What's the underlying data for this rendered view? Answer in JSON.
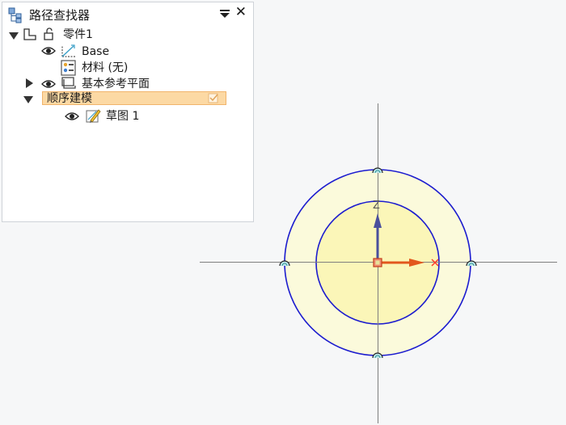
{
  "panel": {
    "title": "路径查找器",
    "title_icon": "tree-hierarchy-icon",
    "menu_icon": "dropdown-menu-icon",
    "close_icon": "close-icon",
    "close_glyph": "✕"
  },
  "tree": {
    "part_label": "零件1",
    "base_label": "Base",
    "material_label": "材料 (无)",
    "ref_planes_label": "基本参考平面",
    "seq_modeling_label": "顺序建模",
    "sketch_label": "草图 1"
  },
  "viewport": {
    "axis_z_label": "Z",
    "colors": {
      "axis_line": "#7f7f7f",
      "circle_stroke": "#1c1ccf",
      "outer_fill": "#fbfadb",
      "inner_fill": "#fbf6b8",
      "z_arrow": "#4a4f9c",
      "x_arrow": "#e2571d",
      "handle": "#2a8f93",
      "highlight": "#fcd9a4"
    }
  }
}
